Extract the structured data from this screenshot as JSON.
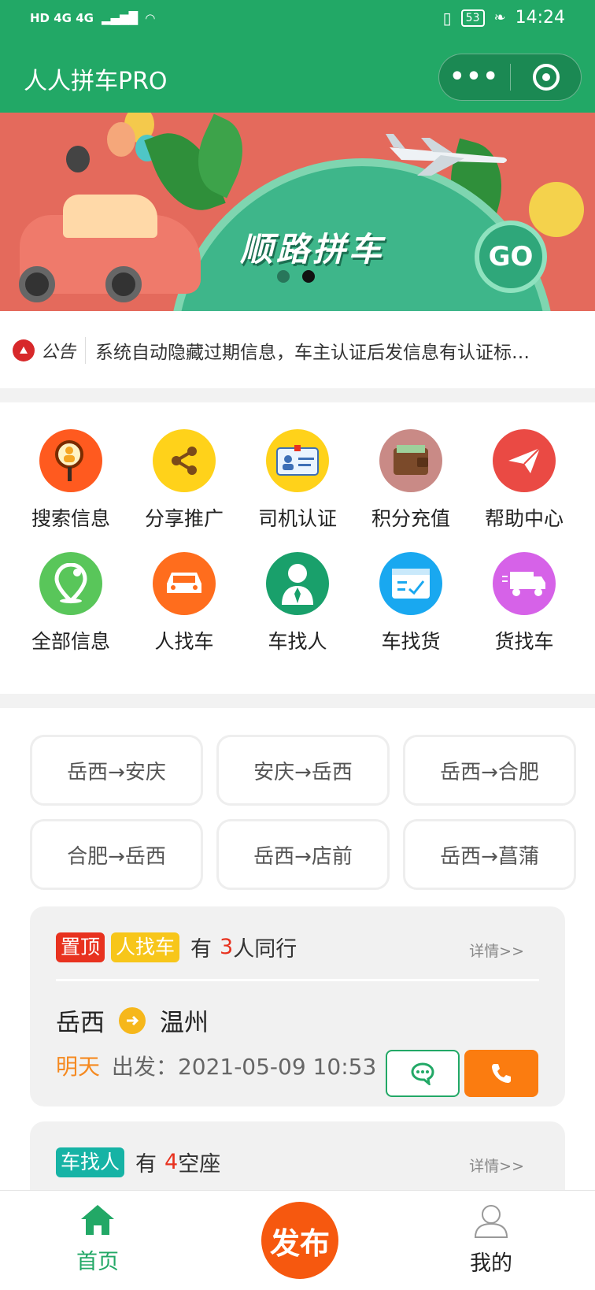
{
  "status_bar": {
    "network": "HD 4G 4G",
    "battery": "53",
    "time": "14:24"
  },
  "app": {
    "title": "人人拼车PRO",
    "capsule_more": "•••"
  },
  "banner": {
    "headline": "顺路拼车",
    "go": "GO",
    "page_index": 2,
    "page_count": 2
  },
  "notice": {
    "label": "公告",
    "text": "系统自动隐藏过期信息，车主认证后发信息有认证标…"
  },
  "menu": [
    {
      "label": "搜索信息",
      "icon": "search-person-icon",
      "color": "#ff5a1f"
    },
    {
      "label": "分享推广",
      "icon": "share-icon",
      "color": "#ffd21a"
    },
    {
      "label": "司机认证",
      "icon": "id-card-icon",
      "color": "#ffd21a"
    },
    {
      "label": "积分充值",
      "icon": "wallet-icon",
      "color": "#c98a86"
    },
    {
      "label": "帮助中心",
      "icon": "paper-plane-icon",
      "color": "#ea4a44"
    },
    {
      "label": "全部信息",
      "icon": "location-pin-icon",
      "color": "#59c65a"
    },
    {
      "label": "人找车",
      "icon": "car-icon",
      "color": "#ff6d1d"
    },
    {
      "label": "车找人",
      "icon": "driver-icon",
      "color": "#19a06b"
    },
    {
      "label": "车找货",
      "icon": "checklist-icon",
      "color": "#19a8f0"
    },
    {
      "label": "货找车",
      "icon": "truck-icon",
      "color": "#d662e8"
    }
  ],
  "routes": [
    "岳西→安庆",
    "安庆→岳西",
    "岳西→合肥",
    "合肥→岳西",
    "岳西→店前",
    "岳西→菖蒲"
  ],
  "cards": [
    {
      "tag_top": "置顶",
      "tag_type": "人找车",
      "count_prefix": "有",
      "count": "3",
      "count_suffix": "人同行",
      "detail": "详情>>",
      "from": "岳西",
      "to": "温州",
      "day": "明天",
      "depart_label": "出发：",
      "depart_time": "2021-05-09 10:53"
    },
    {
      "tag_type": "车找人",
      "count_prefix": "有",
      "count": "4",
      "count_suffix": "空座",
      "detail": "详情>>"
    }
  ],
  "tabbar": {
    "home": "首页",
    "publish": "发布",
    "mine": "我的",
    "active_color": "#22a866"
  }
}
